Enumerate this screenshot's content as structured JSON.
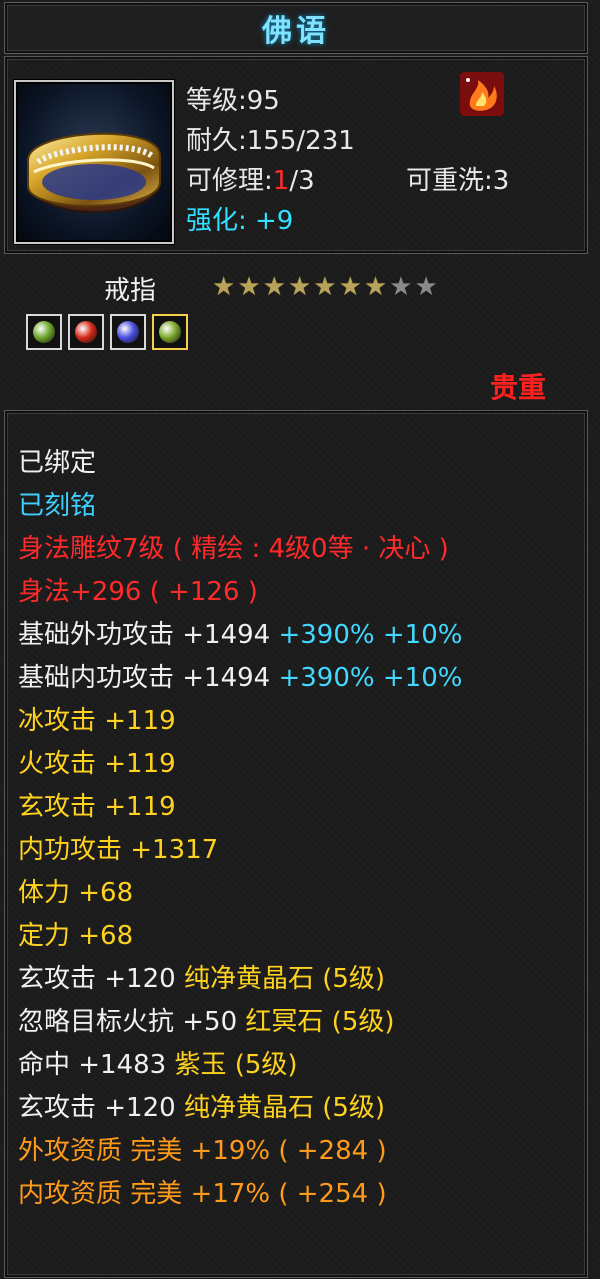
{
  "title": "佛语",
  "item": {
    "level_label": "等级:95",
    "durability_label": "耐久:155/231",
    "repair_prefix": "可修理:",
    "repair_current": "1",
    "repair_suffix": "/3",
    "rewash_label": "可重洗:3",
    "enhance_label": "强化: +9",
    "type": "戒指",
    "stars_total": 9,
    "stars_lit": 7,
    "rarity": "贵重"
  },
  "gems": [
    {
      "name": "yellow-gem",
      "color": "#6ea82b"
    },
    {
      "name": "red-gem",
      "color": "#d42a1a"
    },
    {
      "name": "blue-gem",
      "color": "#4a4fe0"
    },
    {
      "name": "jade-gem",
      "color": "#7da82b"
    }
  ],
  "attributes": {
    "bound": "已绑定",
    "engraved": "已刻铭",
    "carving": "身法雕纹7级 ( 精绘 : 4级0等 · 决心 )",
    "agility": "身法+296 ( +126 )",
    "ext_attack": {
      "label": "基础外功攻击 +1494",
      "pct": "+390%",
      "extra": "+10%"
    },
    "int_attack": {
      "label": "基础内功攻击 +1494",
      "pct": "+390%",
      "extra": "+10%"
    },
    "ice": "冰攻击 +119",
    "fire": "火攻击 +119",
    "mystic": "玄攻击 +119",
    "internal": "内功攻击 +1317",
    "stamina": "体力 +68",
    "focus": "定力 +68",
    "gem1": {
      "stat": "玄攻击 +120",
      "gem": "纯净黄晶石 (5级)"
    },
    "gem2": {
      "stat": "忽略目标火抗 +50",
      "gem": "红冥石 (5级)"
    },
    "gem3": {
      "stat": "命中 +1483",
      "gem": "紫玉 (5级)"
    },
    "gem4": {
      "stat": "玄攻击 +120",
      "gem": "纯净黄晶石 (5级)"
    },
    "ext_aptitude": "外攻资质  完美 +19% ( +284 )",
    "int_aptitude": "内攻资质  完美 +17% ( +254 )"
  }
}
